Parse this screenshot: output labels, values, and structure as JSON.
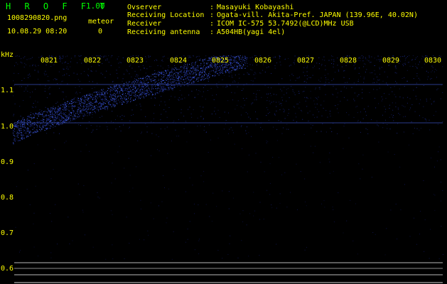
{
  "header": {
    "app_title": "H R O F F T",
    "version": "1.00",
    "filename": "1008290820.png",
    "meteor_label": "meteor",
    "datetime": "10.08.29 08:20",
    "meteor_count": "0"
  },
  "info": [
    {
      "key": "Ovserver",
      "sep": ":",
      "value": "Masayuki Kobayashi"
    },
    {
      "key": "Receiving Location",
      "sep": ":",
      "value": "Ogata-vill. Akita-Pref. JAPAN (139.96E, 40.02N)"
    },
    {
      "key": "Receiver",
      "sep": ":",
      "value": "ICOM IC-575 53.7492(@LCD)MHz USB"
    },
    {
      "key": "Receiving antenna",
      "sep": ":",
      "value": "A504HB(yagi 4el)"
    }
  ],
  "axis": {
    "unit": "kHz",
    "y_labels": [
      "1.1",
      "1.0",
      "0.9",
      "0.8",
      "0.7",
      "0.6"
    ],
    "x_labels": [
      "0821",
      "0822",
      "0823",
      "0824",
      "0825",
      "0826",
      "0827",
      "0828",
      "0829",
      "0830"
    ]
  },
  "colors": {
    "text": "#ffff00",
    "title": "#00ff00",
    "signal": "#3355ff",
    "background": "#000000"
  }
}
